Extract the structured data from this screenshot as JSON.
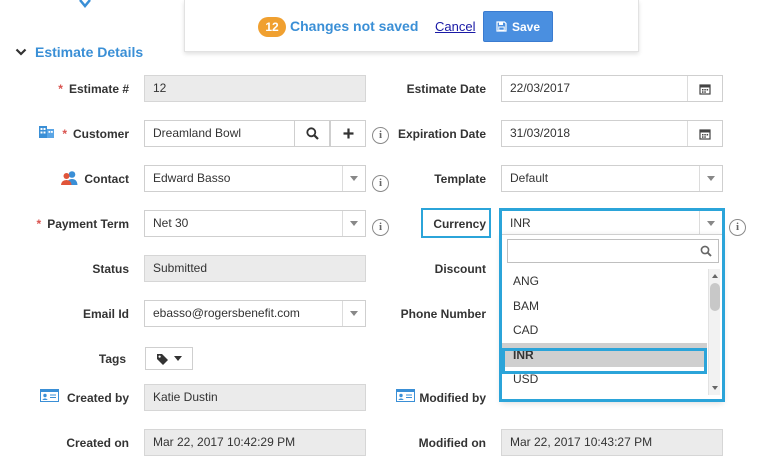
{
  "savebar": {
    "count": "12",
    "message": "Changes not saved",
    "cancel_label": "Cancel",
    "save_label": "Save"
  },
  "section": {
    "title": "Estimate Details"
  },
  "left": {
    "estimate_label": "Estimate #",
    "estimate_value": "12",
    "customer_label": "Customer",
    "customer_value": "Dreamland Bowl",
    "contact_label": "Contact",
    "contact_value": "Edward Basso",
    "payment_label": "Payment Term",
    "payment_value": "Net 30",
    "status_label": "Status",
    "status_value": "Submitted",
    "email_label": "Email Id",
    "email_value": "ebasso@rogersbenefit.com",
    "tags_label": "Tags",
    "created_by_label": "Created by",
    "created_by_value": "Katie Dustin",
    "created_on_label": "Created on",
    "created_on_value": "Mar 22, 2017 10:42:29 PM"
  },
  "right": {
    "estimate_date_label": "Estimate Date",
    "estimate_date_value": "22/03/2017",
    "expiration_label": "Expiration Date",
    "expiration_value": "31/03/2018",
    "template_label": "Template",
    "template_value": "Default",
    "currency_label": "Currency",
    "currency_value": "INR",
    "discount_label": "Discount",
    "phone_label": "Phone Number",
    "modified_by_label": "Modified by",
    "modified_on_label": "Modified on",
    "modified_on_value": "Mar 22, 2017 10:43:27 PM"
  },
  "currency_dropdown": {
    "search_value": "",
    "options": [
      "ANG",
      "BAM",
      "CAD",
      "INR",
      "USD"
    ],
    "selected": "INR"
  },
  "colors": {
    "accent": "#3a8fd6",
    "badge": "#f0a030",
    "save": "#4a8fe0",
    "highlight": "#2ba4d9",
    "required": "#d9534f"
  }
}
